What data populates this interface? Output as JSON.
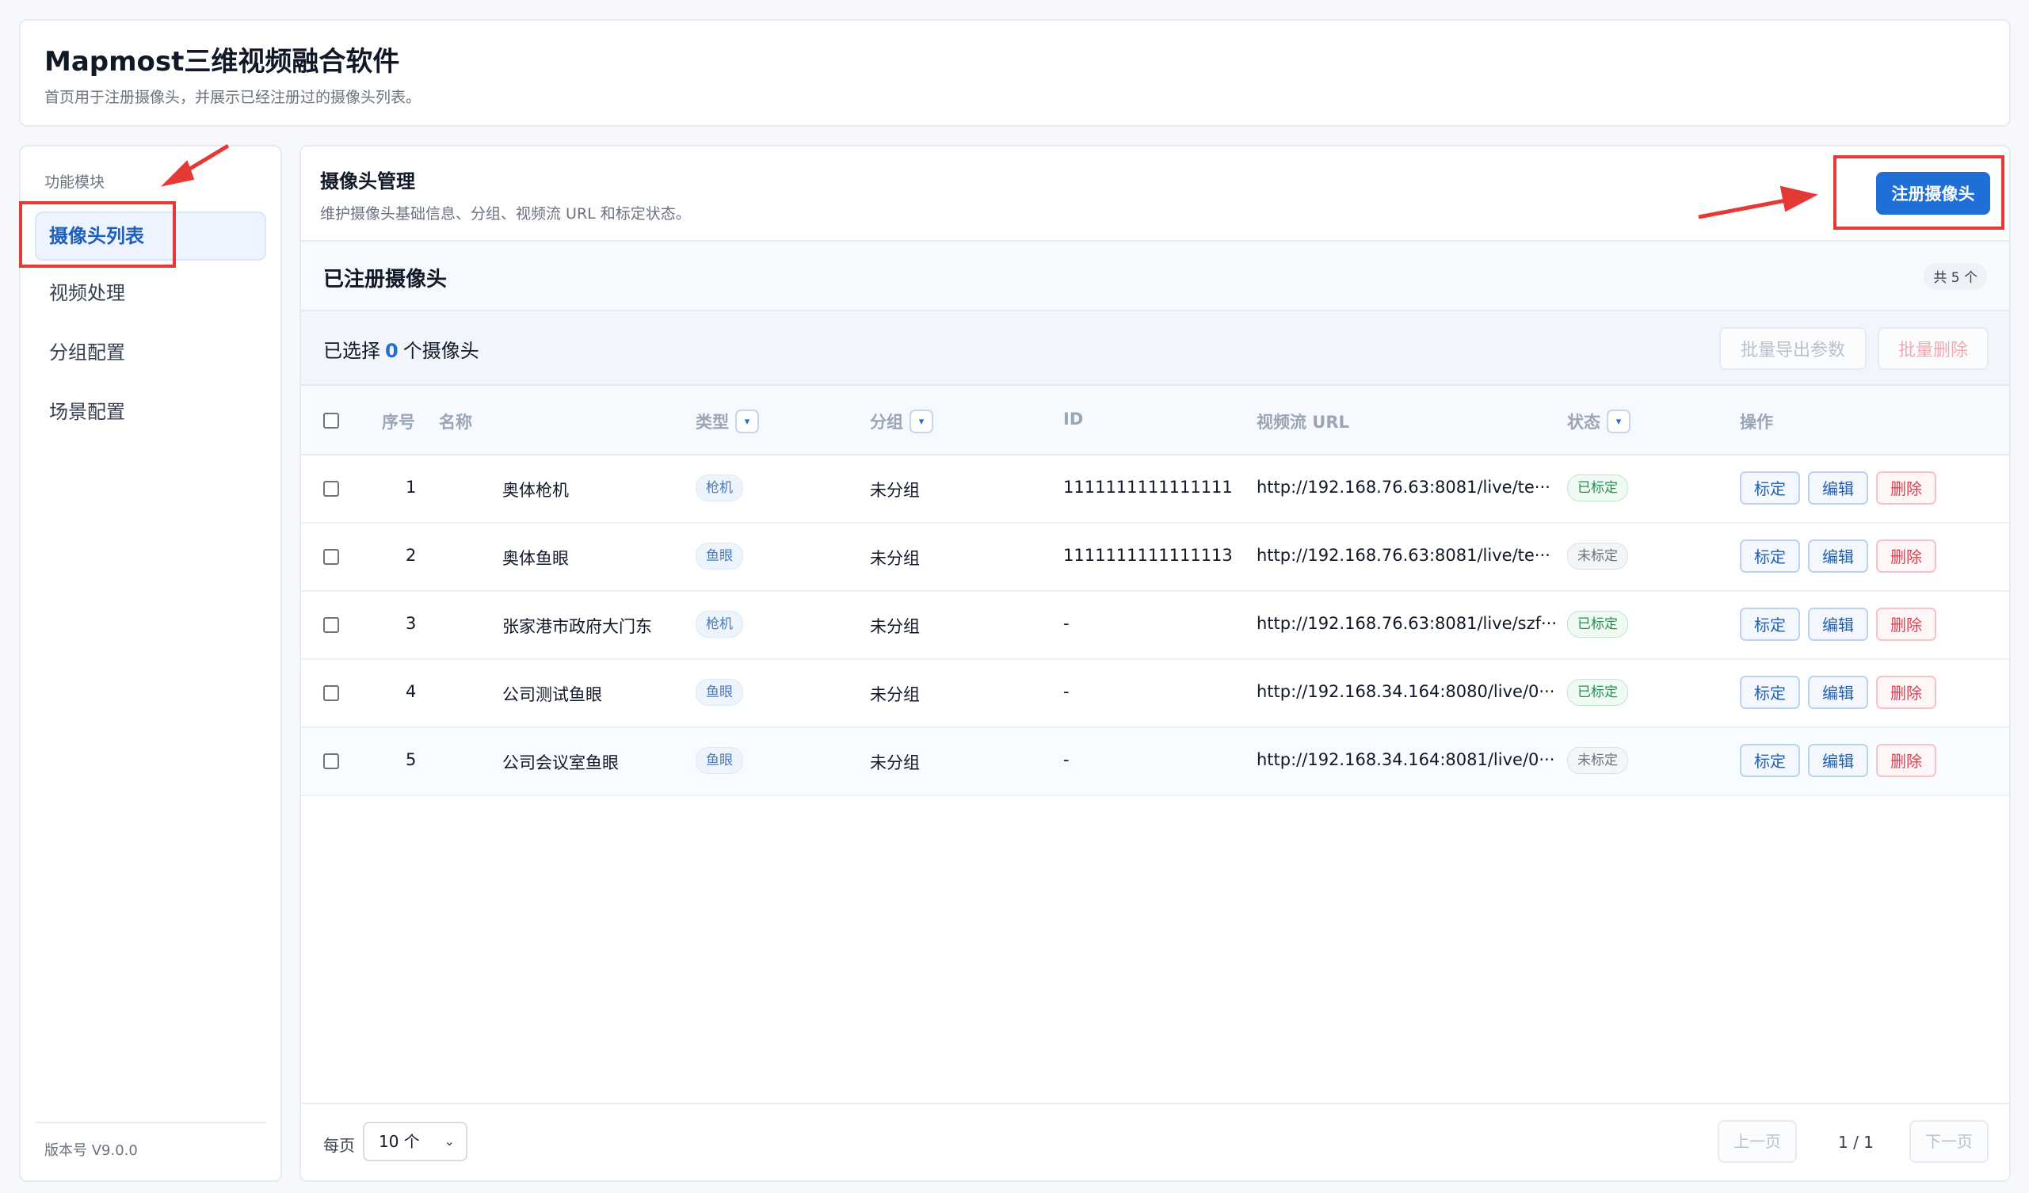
{
  "app": {
    "title": "Mapmost三维视频融合软件",
    "subtitle": "首页用于注册摄像头，并展示已经注册过的摄像头列表。"
  },
  "sidebar": {
    "section_title": "功能模块",
    "items": [
      {
        "label": "摄像头列表",
        "active": true
      },
      {
        "label": "视频处理",
        "active": false
      },
      {
        "label": "分组配置",
        "active": false
      },
      {
        "label": "场景配置",
        "active": false
      }
    ],
    "version": "版本号 V9.0.0"
  },
  "main": {
    "title": "摄像头管理",
    "description": "维护摄像头基础信息、分组、视频流 URL 和标定状态。",
    "register_button": "注册摄像头",
    "registered_title": "已注册摄像头",
    "count_badge": "共 5 个",
    "selection": {
      "prefix": "已选择",
      "count": "0",
      "suffix": "个摄像头"
    },
    "bulk_export": "批量导出参数",
    "bulk_delete": "批量删除"
  },
  "table": {
    "columns": {
      "index": "序号",
      "name": "名称",
      "type": "类型",
      "group": "分组",
      "id": "ID",
      "url": "视频流 URL",
      "status": "状态",
      "actions": "操作"
    },
    "filter_glyph": "▾",
    "rows": [
      {
        "index": "1",
        "name": "奥体枪机",
        "type": "枪机",
        "group": "未分组",
        "id": "1111111111111111",
        "url": "http://192.168.76.63:8081/live/te···",
        "status": "已标定",
        "calibrated": true
      },
      {
        "index": "2",
        "name": "奥体鱼眼",
        "type": "鱼眼",
        "group": "未分组",
        "id": "1111111111111113",
        "url": "http://192.168.76.63:8081/live/te···",
        "status": "未标定",
        "calibrated": false
      },
      {
        "index": "3",
        "name": "张家港市政府大门东",
        "type": "枪机",
        "group": "未分组",
        "id": "-",
        "url": "http://192.168.76.63:8081/live/szf···",
        "status": "已标定",
        "calibrated": true
      },
      {
        "index": "4",
        "name": "公司测试鱼眼",
        "type": "鱼眼",
        "group": "未分组",
        "id": "-",
        "url": "http://192.168.34.164:8080/live/0···",
        "status": "已标定",
        "calibrated": true
      },
      {
        "index": "5",
        "name": "公司会议室鱼眼",
        "type": "鱼眼",
        "group": "未分组",
        "id": "-",
        "url": "http://192.168.34.164:8081/live/0···",
        "status": "未标定",
        "calibrated": false
      }
    ],
    "row_actions": {
      "calibrate": "标定",
      "edit": "编辑",
      "delete": "删除"
    }
  },
  "pagination": {
    "per_page_label": "每页",
    "per_page_value": "10 个",
    "prev": "上一页",
    "page_info": "1 / 1",
    "next": "下一页"
  },
  "colors": {
    "primary": "#1f6fd6",
    "annotation": "#e53935",
    "success": "#2c8a52",
    "danger": "#d94452"
  }
}
